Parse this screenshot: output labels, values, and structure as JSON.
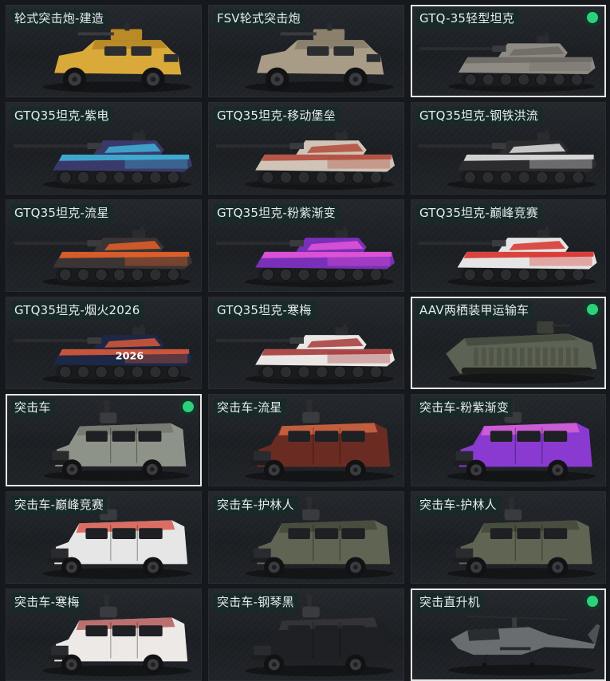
{
  "items": [
    {
      "name": "轮式突击炮-建造",
      "kind": "wheeled",
      "body": "#d9a93a",
      "accent": "#b98a25",
      "selected": false,
      "owned": false
    },
    {
      "name": "FSV轮式突击炮",
      "kind": "wheeled",
      "body": "#a89c86",
      "accent": "#8a806c",
      "selected": false,
      "owned": false
    },
    {
      "name": "GTQ-35轻型坦克",
      "kind": "tank",
      "body": "#8e8b84",
      "accent": "#6d6a64",
      "selected": true,
      "owned": true
    },
    {
      "name": "GTQ35坦克-紫电",
      "kind": "tank",
      "body": "#3a3a6a",
      "accent": "#3fb2d8",
      "selected": false,
      "owned": false
    },
    {
      "name": "GTQ35坦克-移动堡垒",
      "kind": "tank",
      "body": "#cfc4b7",
      "accent": "#b24a3a",
      "selected": false,
      "owned": false
    },
    {
      "name": "GTQ35坦克-钢铁洪流",
      "kind": "tank",
      "body": "#2c2c2e",
      "accent": "#e2e2e2",
      "selected": false,
      "owned": false
    },
    {
      "name": "GTQ35坦克-流星",
      "kind": "tank",
      "body": "#3a3434",
      "accent": "#e8602a",
      "selected": false,
      "owned": false
    },
    {
      "name": "GTQ35坦克-粉紫渐变",
      "kind": "tank",
      "body": "#7a2fb8",
      "accent": "#e455d8",
      "selected": false,
      "owned": false
    },
    {
      "name": "GTQ35坦克-巅峰竞赛",
      "kind": "tank",
      "body": "#e5e5e5",
      "accent": "#d8312a",
      "selected": false,
      "owned": false
    },
    {
      "name": "GTQ35坦克-烟火2026",
      "kind": "tank",
      "body": "#1d2746",
      "accent": "#d95a3a",
      "text": "2026",
      "selected": false,
      "owned": false
    },
    {
      "name": "GTQ35坦克-寒梅",
      "kind": "tank",
      "body": "#e9e6e3",
      "accent": "#a63a3a",
      "selected": false,
      "owned": false
    },
    {
      "name": "AAV两栖装甲运输车",
      "kind": "amphib",
      "body": "#5d6354",
      "accent": "#474d40",
      "selected": true,
      "owned": true
    },
    {
      "name": "突击车",
      "kind": "suv",
      "body": "#8e9389",
      "accent": "#6d7168",
      "selected": true,
      "owned": true
    },
    {
      "name": "突击车-流星",
      "kind": "suv",
      "body": "#6a2c22",
      "accent": "#e8744a",
      "selected": false,
      "owned": false
    },
    {
      "name": "突击车-粉紫渐变",
      "kind": "suv",
      "body": "#8a3ad0",
      "accent": "#e86ad8",
      "selected": false,
      "owned": false
    },
    {
      "name": "突击车-巅峰竞赛",
      "kind": "suv",
      "body": "#e6e6e6",
      "accent": "#d43a2e",
      "selected": false,
      "owned": false
    },
    {
      "name": "突击车-护林人",
      "kind": "suv",
      "body": "#5f6453",
      "accent": "#3f4336",
      "selected": false,
      "owned": false
    },
    {
      "name": "突击车-护林人",
      "kind": "suv",
      "body": "#5f6453",
      "accent": "#3f4336",
      "selected": false,
      "owned": false
    },
    {
      "name": "突击车-寒梅",
      "kind": "suv",
      "body": "#ece9e6",
      "accent": "#a63a3a",
      "selected": false,
      "owned": false
    },
    {
      "name": "突击车-钢琴黑",
      "kind": "suv",
      "body": "#1f2023",
      "accent": "#3a3b40",
      "selected": false,
      "owned": false
    },
    {
      "name": "突击直升机",
      "kind": "heli",
      "body": "#6a6d70",
      "accent": "#4e5154",
      "selected": true,
      "owned": true
    }
  ]
}
